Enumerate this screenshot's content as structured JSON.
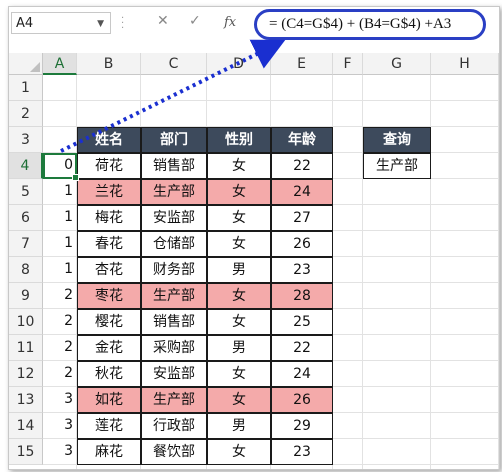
{
  "formula_bar": {
    "namebox": "A4",
    "cancel_glyph": "✕",
    "enter_glyph": "✓",
    "fx": "fx",
    "formula": "= (C4=G$4) + (B4=G$4) +A3"
  },
  "columns": [
    "A",
    "B",
    "C",
    "D",
    "E",
    "F",
    "G",
    "H"
  ],
  "rows": [
    "1",
    "2",
    "3",
    "4",
    "5",
    "6",
    "7",
    "8",
    "9",
    "10",
    "11",
    "12",
    "13",
    "14",
    "15"
  ],
  "table": {
    "headers": [
      "姓名",
      "部门",
      "性别",
      "年龄"
    ],
    "records": [
      {
        "a": "0",
        "name": "荷花",
        "dept": "销售部",
        "gender": "女",
        "age": "22",
        "hl": false
      },
      {
        "a": "1",
        "name": "兰花",
        "dept": "生产部",
        "gender": "女",
        "age": "24",
        "hl": true
      },
      {
        "a": "1",
        "name": "梅花",
        "dept": "安监部",
        "gender": "女",
        "age": "27",
        "hl": false
      },
      {
        "a": "1",
        "name": "春花",
        "dept": "仓储部",
        "gender": "女",
        "age": "26",
        "hl": false
      },
      {
        "a": "1",
        "name": "杏花",
        "dept": "财务部",
        "gender": "男",
        "age": "23",
        "hl": false
      },
      {
        "a": "2",
        "name": "枣花",
        "dept": "生产部",
        "gender": "女",
        "age": "28",
        "hl": true
      },
      {
        "a": "2",
        "name": "樱花",
        "dept": "销售部",
        "gender": "女",
        "age": "25",
        "hl": false
      },
      {
        "a": "2",
        "name": "金花",
        "dept": "采购部",
        "gender": "男",
        "age": "22",
        "hl": false
      },
      {
        "a": "2",
        "name": "秋花",
        "dept": "安监部",
        "gender": "女",
        "age": "24",
        "hl": false
      },
      {
        "a": "3",
        "name": "如花",
        "dept": "生产部",
        "gender": "女",
        "age": "26",
        "hl": true
      },
      {
        "a": "3",
        "name": "莲花",
        "dept": "行政部",
        "gender": "男",
        "age": "29",
        "hl": false
      },
      {
        "a": "3",
        "name": "麻花",
        "dept": "餐饮部",
        "gender": "女",
        "age": "23",
        "hl": false
      }
    ]
  },
  "query": {
    "header": "查询",
    "value": "生产部"
  },
  "colors": {
    "header_bg": "#3d4a5c",
    "highlight": "#f4aaaa",
    "arrow": "#1a2fd0",
    "selection": "#1d7a3c"
  }
}
